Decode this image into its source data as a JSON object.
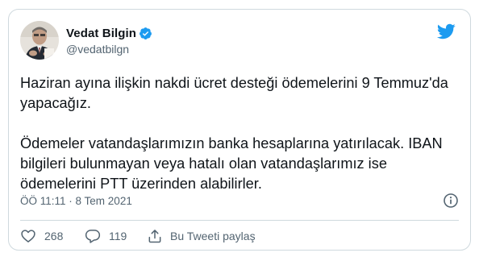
{
  "tweet": {
    "author_name": "Vedat Bilgin",
    "author_handle": "@vedatbilgn",
    "text": "Haziran ayına ilişkin nakdi ücret desteği ödemelerini 9 Temmuz'da yapacağız.\n\nÖdemeler vatandaşlarımızın banka hesaplarına yatırılacak. IBAN bilgileri bulunmayan veya hatalı olan vatandaşlarımız ise ödemelerini PTT üzerinden alabilirler.",
    "timestamp": "ÖÖ 11:11 · 8 Tem 2021"
  },
  "actions": {
    "like_count": "268",
    "reply_count": "119",
    "share_label": "Bu Tweeti paylaş"
  },
  "icons": {
    "verified": "verified-badge-icon",
    "logo": "twitter-bird-icon",
    "info": "info-icon",
    "like": "heart-icon",
    "reply": "reply-bubble-icon",
    "share": "share-icon"
  },
  "colors": {
    "twitter_blue": "#1d9bf0",
    "text_primary": "#0f1419",
    "text_secondary": "#536471",
    "border": "#cfd9de"
  }
}
